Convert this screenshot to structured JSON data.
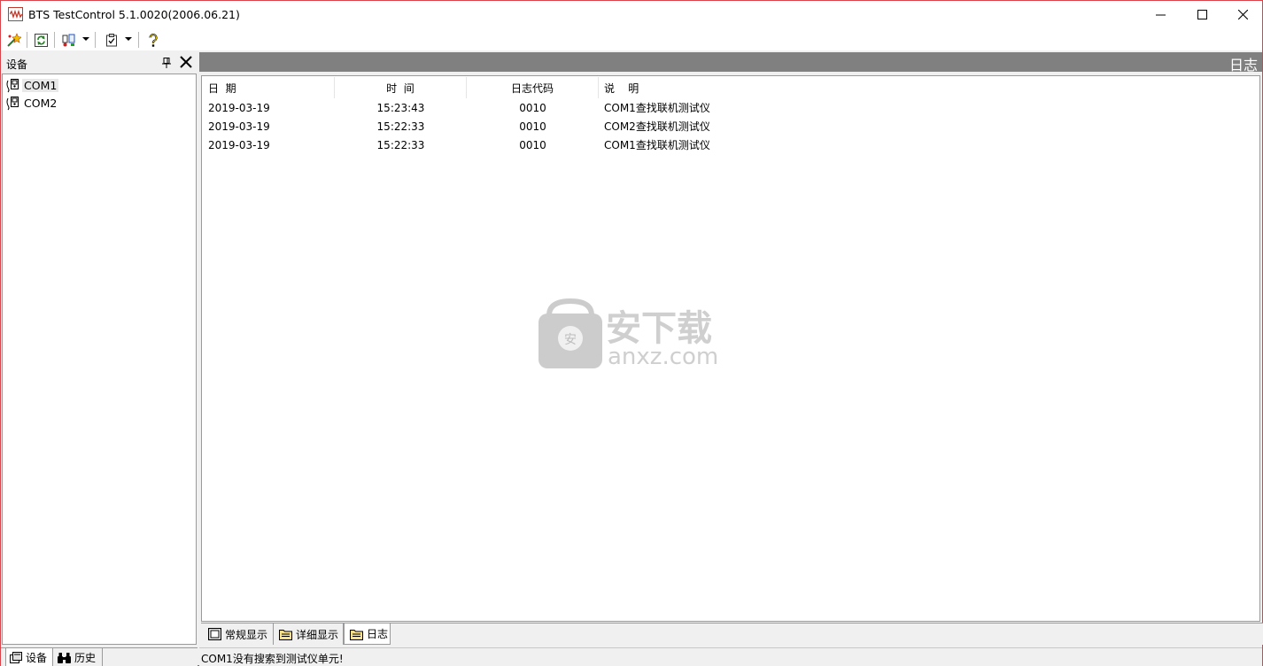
{
  "window": {
    "title": "BTS TestControl 5.1.0020(2006.06.21)"
  },
  "toolbar": {
    "buttons": [
      "wand-icon",
      "refresh-icon",
      "settings-dropdown-icon",
      "checklist-dropdown-icon",
      "help-icon"
    ]
  },
  "left_pane": {
    "title": "设备",
    "devices": [
      {
        "label": "COM1",
        "selected": true
      },
      {
        "label": "COM2",
        "selected": false
      }
    ],
    "tabs": [
      {
        "label": "设备",
        "active": true
      },
      {
        "label": "历史",
        "active": false
      }
    ]
  },
  "log": {
    "title": "日志",
    "columns": [
      "日  期",
      "时  间",
      "日志代码",
      "说    明"
    ],
    "rows": [
      {
        "date": "2019-03-19",
        "time": "15:23:43",
        "code": "0010",
        "desc": "COM1查找联机测试仪"
      },
      {
        "date": "2019-03-19",
        "time": "15:22:33",
        "code": "0010",
        "desc": "COM2查找联机测试仪"
      },
      {
        "date": "2019-03-19",
        "time": "15:22:33",
        "code": "0010",
        "desc": "COM1查找联机测试仪"
      }
    ]
  },
  "bottom_tabs": [
    {
      "label": "常规显示",
      "active": false
    },
    {
      "label": "详细显示",
      "active": false
    },
    {
      "label": "日志",
      "active": true
    }
  ],
  "watermark": {
    "name": "安下载",
    "url": "anxz.com"
  },
  "status": {
    "message": "COM1没有搜索到测试仪单元!"
  },
  "colors": {
    "window_border": "#d9444a",
    "log_header_bg": "#808080"
  }
}
